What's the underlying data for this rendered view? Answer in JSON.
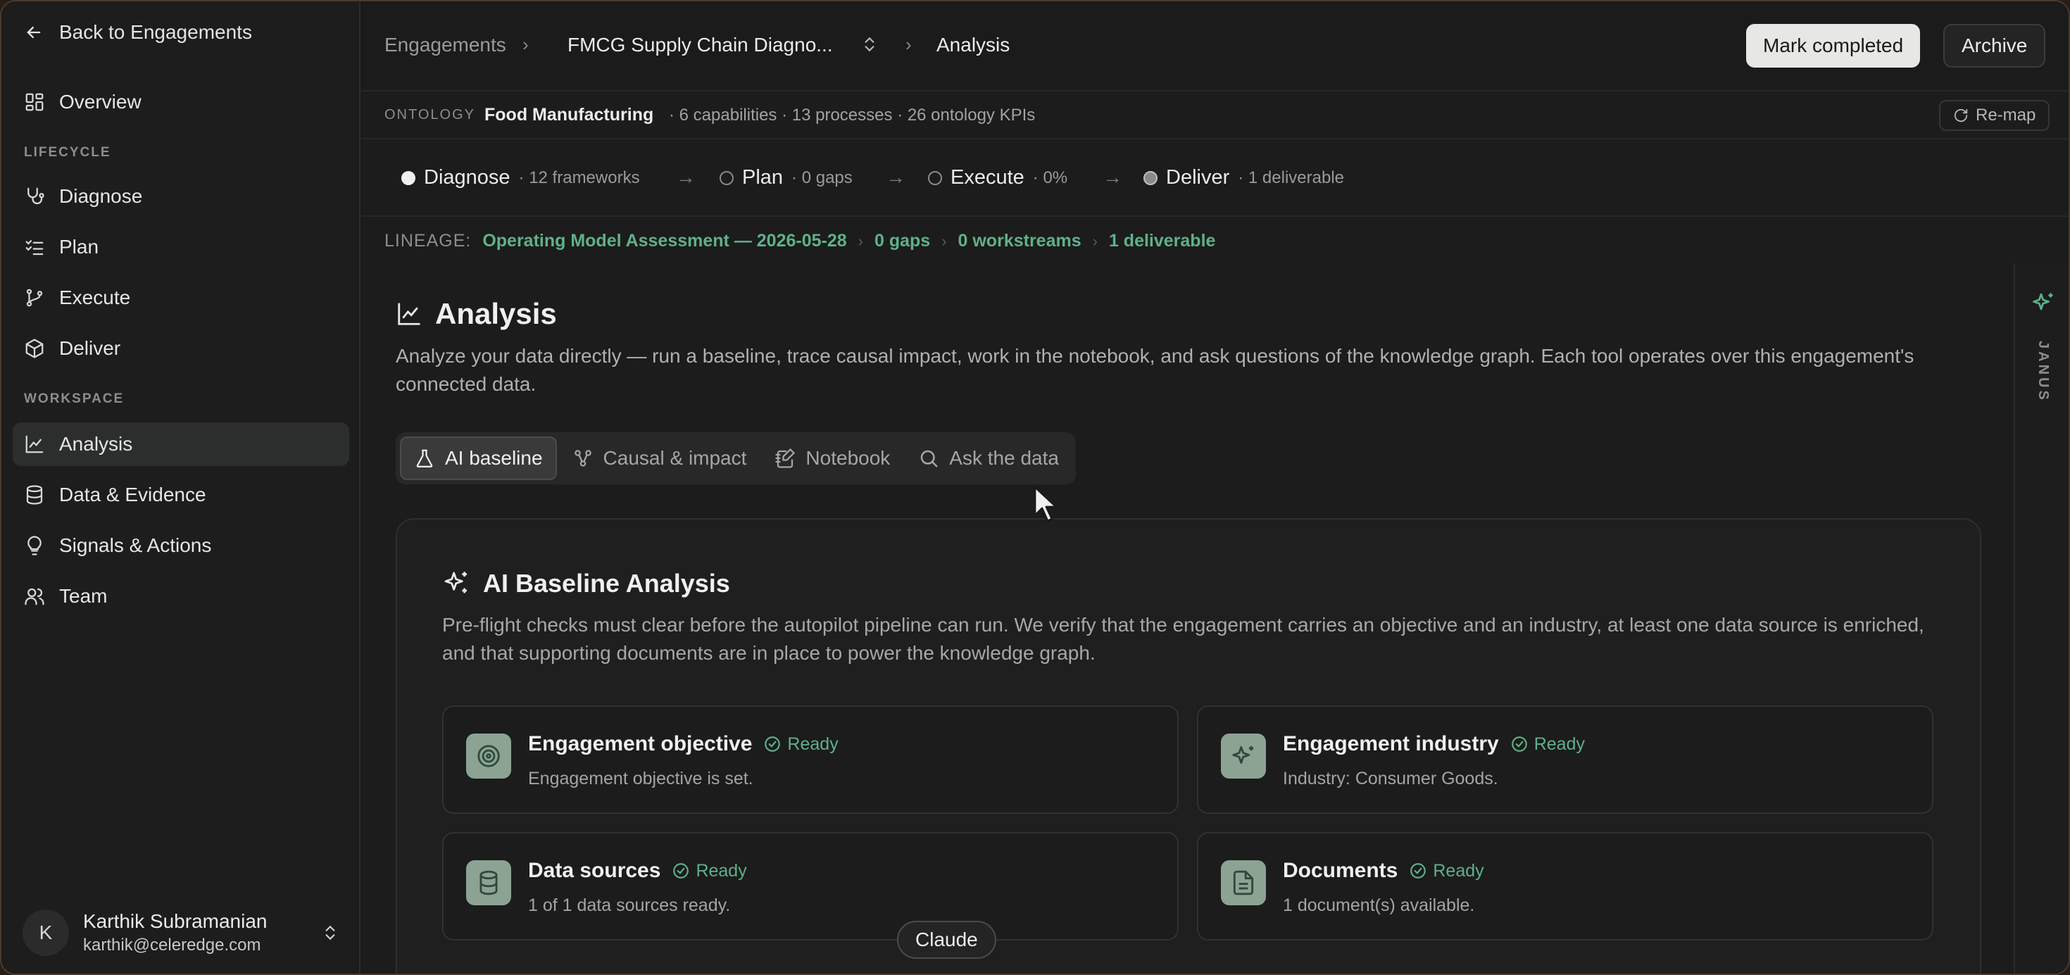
{
  "sidebar": {
    "back_label": "Back to Engagements",
    "overview": "Overview",
    "lifecycle_label": "LIFECYCLE",
    "lifecycle": [
      "Diagnose",
      "Plan",
      "Execute",
      "Deliver"
    ],
    "workspace_label": "WORKSPACE",
    "workspace": [
      "Analysis",
      "Data & Evidence",
      "Signals & Actions",
      "Team"
    ],
    "active_item": "Analysis",
    "user": {
      "initial": "K",
      "name": "Karthik Subramanian",
      "email": "karthik@celeredge.com"
    }
  },
  "header": {
    "breadcrumbs": [
      "Engagements",
      "FMCG Supply Chain Diagno...",
      "Analysis"
    ],
    "mark_completed": "Mark completed",
    "archive": "Archive"
  },
  "ontology": {
    "label": "ONTOLOGY",
    "name": "Food Manufacturing",
    "meta": "· 6 capabilities · 13 processes · 26 ontology KPIs",
    "remap": "Re-map"
  },
  "stages": [
    {
      "name": "Diagnose",
      "sub": "· 12 frameworks",
      "state": "active"
    },
    {
      "name": "Plan",
      "sub": "· 0 gaps",
      "state": "empty"
    },
    {
      "name": "Execute",
      "sub": "· 0%",
      "state": "empty"
    },
    {
      "name": "Deliver",
      "sub": "· 1 deliverable",
      "state": "partial"
    }
  ],
  "lineage": {
    "label": "LINEAGE:",
    "items": [
      "Operating Model Assessment — 2026-05-28",
      "0 gaps",
      "0 workstreams",
      "1 deliverable"
    ]
  },
  "page": {
    "title": "Analysis",
    "description": "Analyze your data directly — run a baseline, trace causal impact, work in the notebook, and ask questions of the knowledge graph. Each tool operates over this engagement's connected data."
  },
  "tabs": [
    "AI baseline",
    "Causal & impact",
    "Notebook",
    "Ask the data"
  ],
  "active_tab": "AI baseline",
  "card": {
    "title": "AI Baseline Analysis",
    "description": "Pre-flight checks must clear before the autopilot pipeline can run. We verify that the engagement carries an objective and an industry, at least one data source is enriched, and that supporting documents are in place to power the knowledge graph.",
    "checks": [
      {
        "title": "Engagement objective",
        "status": "Ready",
        "detail": "Engagement objective is set.",
        "icon": "target-icon"
      },
      {
        "title": "Engagement industry",
        "status": "Ready",
        "detail": "Industry: Consumer Goods.",
        "icon": "sparkle-icon"
      },
      {
        "title": "Data sources",
        "status": "Ready",
        "detail": "1 of 1 data sources ready.",
        "icon": "database-icon"
      },
      {
        "title": "Documents",
        "status": "Ready",
        "detail": "1 document(s) available.",
        "icon": "document-icon"
      }
    ]
  },
  "right_rail": {
    "label": "JANUS"
  },
  "tooltip": "Claude",
  "colors": {
    "accent_green": "#5fb08a",
    "icon_tile": "#8ca394",
    "background": "#1b1c1b"
  }
}
